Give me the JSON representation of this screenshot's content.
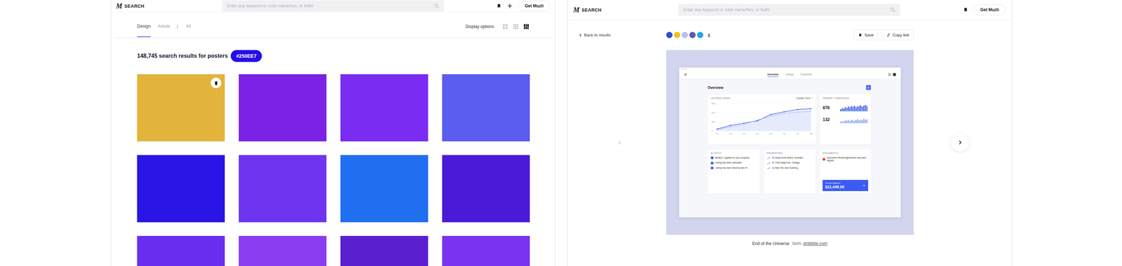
{
  "left": {
    "header": {
      "logo_mark": "M",
      "logo_label": "SEARCH",
      "search_placeholder": "Enter any keyword or color-name/hex, or both!",
      "cta": "Get Muzli"
    },
    "tabs": [
      {
        "label": "Design",
        "selected": true
      },
      {
        "label": "Article",
        "selected": false
      },
      {
        "label": "All",
        "selected": false
      }
    ],
    "tab_separator": "|",
    "display_options": {
      "label": "Display options",
      "views": [
        {
          "view": "grid-large",
          "selected": false
        },
        {
          "view": "grid-small",
          "selected": false
        },
        {
          "view": "masonry",
          "selected": true
        }
      ]
    },
    "results": {
      "summary": "148,745 search results for posters",
      "color_chip": "#250EE7"
    },
    "cards": [
      {
        "color": "#e2b43c",
        "hovered": true
      },
      {
        "color": "#7b22e6",
        "hovered": false
      },
      {
        "color": "#7a2cf2",
        "hovered": false
      },
      {
        "color": "#5b5cf0",
        "hovered": false
      },
      {
        "color": "#2a14e6",
        "hovered": false
      },
      {
        "color": "#6f34f0",
        "hovered": false
      },
      {
        "color": "#1f6ff0",
        "hovered": false
      },
      {
        "color": "#4a1ad8",
        "hovered": false
      },
      {
        "color": "#6a2ef0",
        "hovered": false
      },
      {
        "color": "#8a3cf0",
        "hovered": false
      },
      {
        "color": "#5a20d0",
        "hovered": false
      },
      {
        "color": "#7a34f0",
        "hovered": false
      }
    ]
  },
  "right": {
    "header": {
      "logo_mark": "M",
      "logo_label": "SEARCH",
      "search_placeholder": "Enter any keyword or color-name/hex, or both!",
      "cta": "Get Muzli"
    },
    "back": "Back to results",
    "palette": [
      {
        "color": "#2c4fd6"
      },
      {
        "color": "#f3c11c"
      },
      {
        "color": "#bcc0ec"
      },
      {
        "color": "#5d5ba9"
      },
      {
        "color": "#2aa5e1"
      }
    ],
    "actions": [
      {
        "label": "Save",
        "kind": "save"
      },
      {
        "label": "Copy link",
        "kind": "copy"
      }
    ],
    "nav": {
      "prev_disabled": true,
      "next_disabled": false
    },
    "preview": {
      "dashboard": {
        "nav": [
          {
            "label": "Overview",
            "selected": true
          },
          {
            "label": "Listings",
            "selected": false
          },
          {
            "label": "Properties",
            "selected": false
          }
        ],
        "title": "Overview",
        "chart": {
          "title": "LISTINGS VIEWS",
          "period": "October 2019",
          "y_ticks": [
            "300",
            "200",
            "100",
            "0"
          ],
          "x_ticks": [
            "01",
            "02",
            "03",
            "04",
            "05",
            "06",
            "07",
            "08"
          ],
          "series": [
            {
              "kind": "primary",
              "values": [
                20,
                60,
                85,
                110,
                180,
                210,
                235,
                245
              ]
            },
            {
              "kind": "secondary",
              "values": [
                10,
                45,
                70,
                120,
                160,
                190,
                205,
                215
              ]
            }
          ]
        },
        "campaigns": {
          "title": "PRIMARY CAMPAIGNS",
          "rows": [
            {
              "value": "876",
              "bars": [
                6,
                9,
                8,
                12,
                10,
                14,
                11,
                15,
                13,
                16,
                12,
                14,
                15,
                17,
                13,
                16,
                18,
                15
              ]
            },
            {
              "value": "132",
              "bars": [
                4,
                6,
                5,
                8,
                7,
                9,
                6,
                10,
                8,
                7,
                9,
                11,
                8,
                10,
                9,
                12,
                10,
                11
              ]
            }
          ]
        },
        "activity": {
          "title": "ACTIVITY",
          "items": [
            "Bobby F. applied for your property",
            "Listing has been activated",
            "Listing has been liked by Alex R."
          ]
        },
        "properties": {
          "title": "PROPERTIES",
          "items": [
            "22 Hyatt Hook Street, Dunellen",
            "22 Thornridge Ave, Cottage",
            "12 Main Rd, Bed Subbing"
          ]
        },
        "documents": {
          "title": "DOCUMENTS",
          "items": [
            "Document Rental Agreement has been signed"
          ],
          "balance_label": "Current Balance",
          "balance": "$11,449.00"
        }
      }
    },
    "caption": {
      "title": "End of the Universe",
      "source_label": "form:",
      "source": "dribbble.com"
    }
  }
}
